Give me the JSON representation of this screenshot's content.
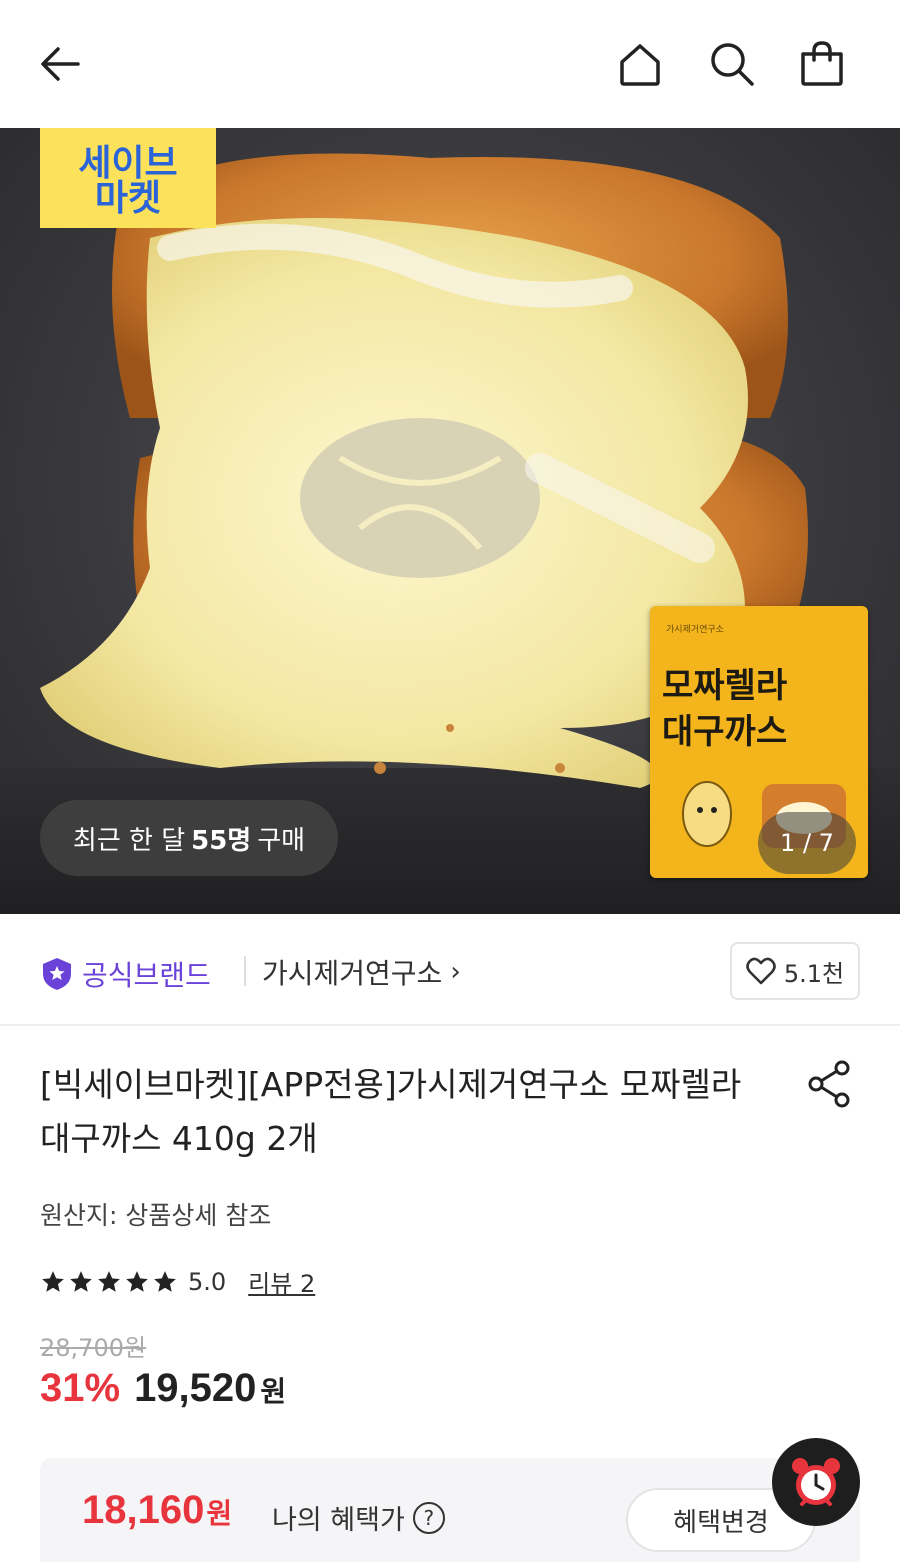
{
  "header": {
    "back_icon": "arrow-left-icon",
    "home_icon": "home-icon",
    "search_icon": "search-icon",
    "bag_icon": "shopping-bag-icon"
  },
  "hero": {
    "market_badge_line1": "세이브",
    "market_badge_line2": "마켓",
    "recent_buy_prefix": "최근 한 달",
    "recent_buy_count": "55명",
    "recent_buy_suffix": "구매",
    "package_small": "가시제거연구소",
    "package_title_1": "모짜렐라",
    "package_title_2": "대구까스",
    "image_counter": "1 / 7"
  },
  "brand": {
    "official_label": "공식브랜드",
    "store_name": "가시제거연구소",
    "likes": "5.1천",
    "accent_color": "#6a42d8"
  },
  "product": {
    "title": "[빅세이브마켓][APP전용]가시제거연구소 모짜렐라 대구까스 410g 2개",
    "origin": "원산지: 상품상세 참조",
    "rating": "5.0",
    "stars": 5,
    "review_link": "리뷰 2",
    "original_price": "28,700원",
    "discount": "31%",
    "sale_price": "19,520",
    "sale_unit": "원",
    "discount_color": "#e8343c"
  },
  "benefit": {
    "price": "18,160",
    "unit": "원",
    "label": "나의 혜택가",
    "help": "?",
    "change_button": "혜택변경"
  }
}
